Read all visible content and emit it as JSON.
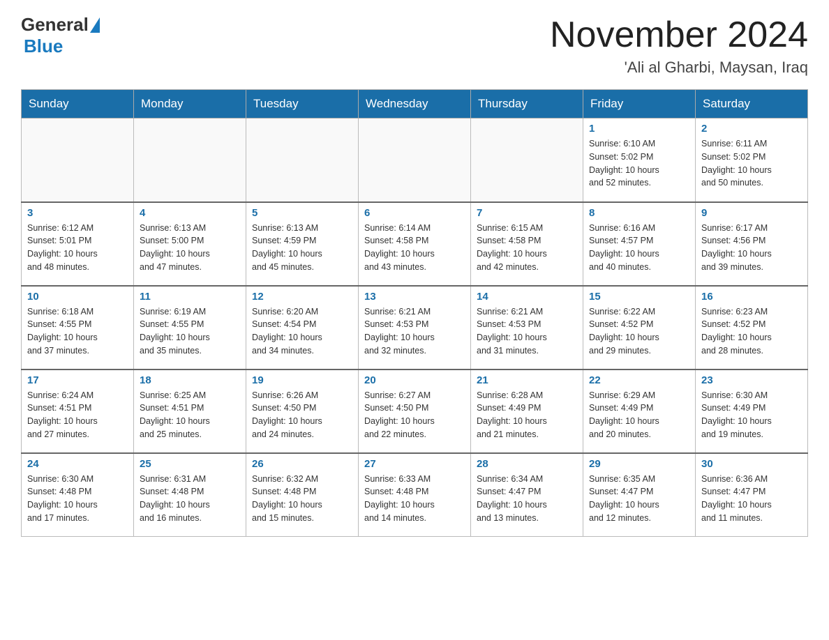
{
  "header": {
    "logo": {
      "general": "General",
      "blue": "Blue"
    },
    "title": "November 2024",
    "subtitle": "'Ali al Gharbi, Maysan, Iraq"
  },
  "days_of_week": [
    "Sunday",
    "Monday",
    "Tuesday",
    "Wednesday",
    "Thursday",
    "Friday",
    "Saturday"
  ],
  "weeks": [
    [
      {
        "day": "",
        "info": ""
      },
      {
        "day": "",
        "info": ""
      },
      {
        "day": "",
        "info": ""
      },
      {
        "day": "",
        "info": ""
      },
      {
        "day": "",
        "info": ""
      },
      {
        "day": "1",
        "info": "Sunrise: 6:10 AM\nSunset: 5:02 PM\nDaylight: 10 hours\nand 52 minutes."
      },
      {
        "day": "2",
        "info": "Sunrise: 6:11 AM\nSunset: 5:02 PM\nDaylight: 10 hours\nand 50 minutes."
      }
    ],
    [
      {
        "day": "3",
        "info": "Sunrise: 6:12 AM\nSunset: 5:01 PM\nDaylight: 10 hours\nand 48 minutes."
      },
      {
        "day": "4",
        "info": "Sunrise: 6:13 AM\nSunset: 5:00 PM\nDaylight: 10 hours\nand 47 minutes."
      },
      {
        "day": "5",
        "info": "Sunrise: 6:13 AM\nSunset: 4:59 PM\nDaylight: 10 hours\nand 45 minutes."
      },
      {
        "day": "6",
        "info": "Sunrise: 6:14 AM\nSunset: 4:58 PM\nDaylight: 10 hours\nand 43 minutes."
      },
      {
        "day": "7",
        "info": "Sunrise: 6:15 AM\nSunset: 4:58 PM\nDaylight: 10 hours\nand 42 minutes."
      },
      {
        "day": "8",
        "info": "Sunrise: 6:16 AM\nSunset: 4:57 PM\nDaylight: 10 hours\nand 40 minutes."
      },
      {
        "day": "9",
        "info": "Sunrise: 6:17 AM\nSunset: 4:56 PM\nDaylight: 10 hours\nand 39 minutes."
      }
    ],
    [
      {
        "day": "10",
        "info": "Sunrise: 6:18 AM\nSunset: 4:55 PM\nDaylight: 10 hours\nand 37 minutes."
      },
      {
        "day": "11",
        "info": "Sunrise: 6:19 AM\nSunset: 4:55 PM\nDaylight: 10 hours\nand 35 minutes."
      },
      {
        "day": "12",
        "info": "Sunrise: 6:20 AM\nSunset: 4:54 PM\nDaylight: 10 hours\nand 34 minutes."
      },
      {
        "day": "13",
        "info": "Sunrise: 6:21 AM\nSunset: 4:53 PM\nDaylight: 10 hours\nand 32 minutes."
      },
      {
        "day": "14",
        "info": "Sunrise: 6:21 AM\nSunset: 4:53 PM\nDaylight: 10 hours\nand 31 minutes."
      },
      {
        "day": "15",
        "info": "Sunrise: 6:22 AM\nSunset: 4:52 PM\nDaylight: 10 hours\nand 29 minutes."
      },
      {
        "day": "16",
        "info": "Sunrise: 6:23 AM\nSunset: 4:52 PM\nDaylight: 10 hours\nand 28 minutes."
      }
    ],
    [
      {
        "day": "17",
        "info": "Sunrise: 6:24 AM\nSunset: 4:51 PM\nDaylight: 10 hours\nand 27 minutes."
      },
      {
        "day": "18",
        "info": "Sunrise: 6:25 AM\nSunset: 4:51 PM\nDaylight: 10 hours\nand 25 minutes."
      },
      {
        "day": "19",
        "info": "Sunrise: 6:26 AM\nSunset: 4:50 PM\nDaylight: 10 hours\nand 24 minutes."
      },
      {
        "day": "20",
        "info": "Sunrise: 6:27 AM\nSunset: 4:50 PM\nDaylight: 10 hours\nand 22 minutes."
      },
      {
        "day": "21",
        "info": "Sunrise: 6:28 AM\nSunset: 4:49 PM\nDaylight: 10 hours\nand 21 minutes."
      },
      {
        "day": "22",
        "info": "Sunrise: 6:29 AM\nSunset: 4:49 PM\nDaylight: 10 hours\nand 20 minutes."
      },
      {
        "day": "23",
        "info": "Sunrise: 6:30 AM\nSunset: 4:49 PM\nDaylight: 10 hours\nand 19 minutes."
      }
    ],
    [
      {
        "day": "24",
        "info": "Sunrise: 6:30 AM\nSunset: 4:48 PM\nDaylight: 10 hours\nand 17 minutes."
      },
      {
        "day": "25",
        "info": "Sunrise: 6:31 AM\nSunset: 4:48 PM\nDaylight: 10 hours\nand 16 minutes."
      },
      {
        "day": "26",
        "info": "Sunrise: 6:32 AM\nSunset: 4:48 PM\nDaylight: 10 hours\nand 15 minutes."
      },
      {
        "day": "27",
        "info": "Sunrise: 6:33 AM\nSunset: 4:48 PM\nDaylight: 10 hours\nand 14 minutes."
      },
      {
        "day": "28",
        "info": "Sunrise: 6:34 AM\nSunset: 4:47 PM\nDaylight: 10 hours\nand 13 minutes."
      },
      {
        "day": "29",
        "info": "Sunrise: 6:35 AM\nSunset: 4:47 PM\nDaylight: 10 hours\nand 12 minutes."
      },
      {
        "day": "30",
        "info": "Sunrise: 6:36 AM\nSunset: 4:47 PM\nDaylight: 10 hours\nand 11 minutes."
      }
    ]
  ]
}
